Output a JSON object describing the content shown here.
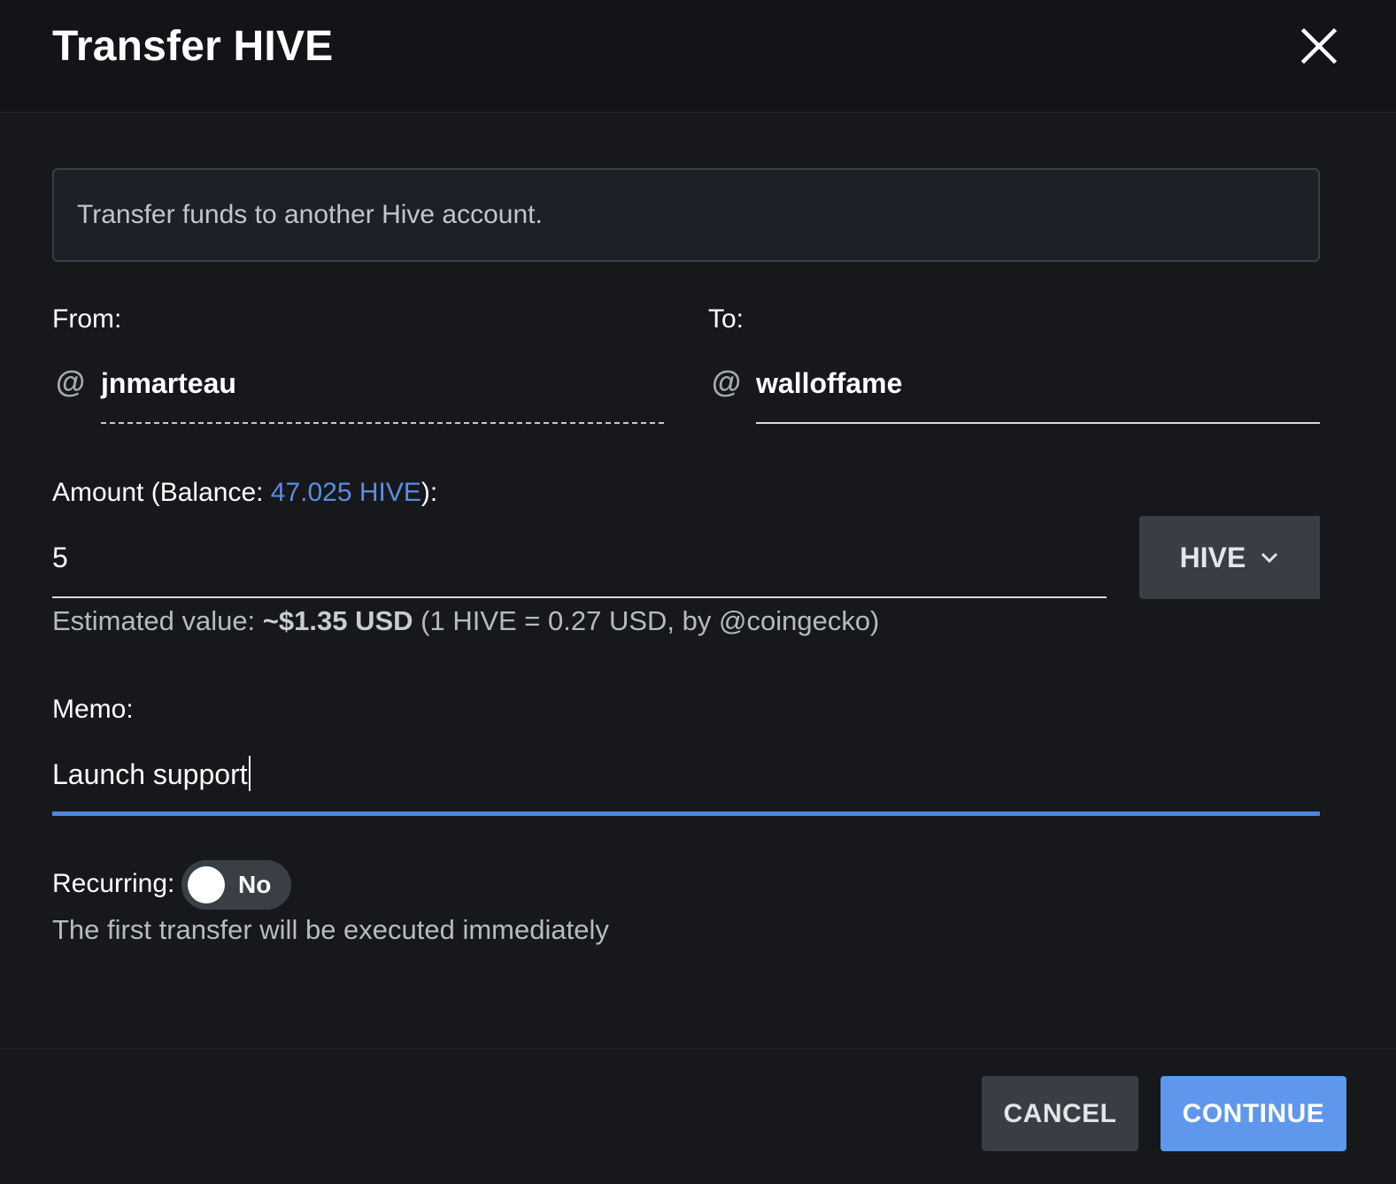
{
  "header": {
    "title": "Transfer HIVE",
    "close_icon": "close-icon"
  },
  "info": {
    "text": "Transfer funds to another Hive account."
  },
  "from": {
    "label": "From:",
    "at_symbol": "@",
    "value": "jnmarteau"
  },
  "to": {
    "label": "To:",
    "at_symbol": "@",
    "value": "walloffame"
  },
  "amount": {
    "label_prefix": "Amount (Balance: ",
    "balance": "47.025 HIVE",
    "label_suffix": "):",
    "value": "5",
    "currency": "HIVE",
    "currency_icon": "chevron-down-icon"
  },
  "estimate": {
    "prefix": "Estimated value: ",
    "value": "~$1.35 USD",
    "suffix": " (1 HIVE = 0.27 USD, by @coingecko)"
  },
  "memo": {
    "label": "Memo:",
    "value": "Launch support"
  },
  "recurring": {
    "label": "Recurring:",
    "toggle_text": "No",
    "hint": "The first transfer will be executed immediately"
  },
  "footer": {
    "cancel_label": "CANCEL",
    "continue_label": "CONTINUE"
  },
  "colors": {
    "accent": "#5e97ec",
    "link": "#5b8de3",
    "background": "#16181b"
  }
}
